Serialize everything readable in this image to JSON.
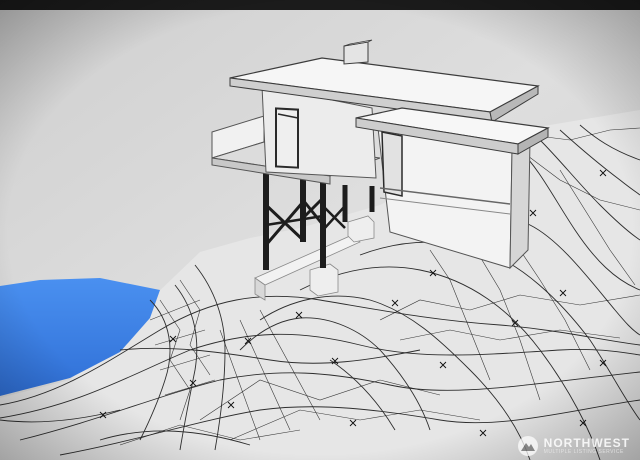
{
  "watermark": {
    "brand": "NORTHWEST",
    "sub": "MULTIPLE LISTING SERVICE",
    "icon": "mountain-icon"
  },
  "scene": {
    "water_color": "#3a80e6",
    "building_color": "#e9e9e9",
    "background_color": "#dcdcdc"
  }
}
